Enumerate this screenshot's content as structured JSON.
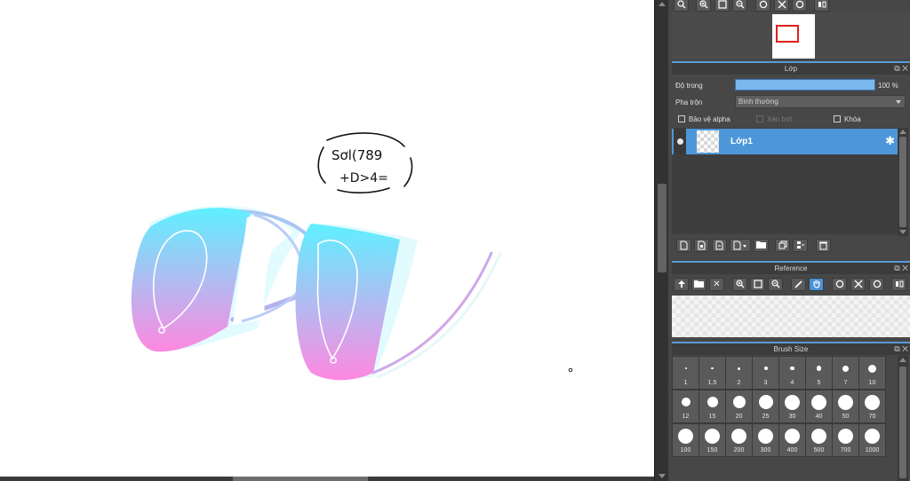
{
  "colors": {
    "accent": "#4d97d8",
    "gradient_cyan": "#5ff0ff",
    "gradient_pink": "#ff8fe0"
  },
  "canvas": {
    "sketch_note_line1": "Sơl(789",
    "sketch_note_line2": "+D>4="
  },
  "navigator": {
    "toolbar_icons": [
      "zoom-in-icon",
      "zoom-in-plus-icon",
      "fit-window-icon",
      "zoom-out-icon",
      "rotate-left-icon",
      "fit-icon",
      "rotate-right-icon",
      "flip-icon"
    ]
  },
  "layer_panel": {
    "title": "Lớp",
    "opacity_label": "Độ trong",
    "opacity_value": "100 %",
    "opacity_fraction": 1.0,
    "blend_label": "Pha trộn",
    "blend_value": "Bình thường",
    "protect_alpha_label": "Bảo vệ alpha",
    "clipping_label": "Xén bớt",
    "lock_label": "Khóa",
    "layers": [
      {
        "name": "Lớp1",
        "selected": true,
        "visible": true
      }
    ],
    "action_icons": [
      "new-layer-icon",
      "new-layer-8bit-icon",
      "new-layer-1bit-icon",
      "add-layer-menu-icon",
      "folder-icon",
      "duplicate-icon",
      "merge-icon",
      "delete-icon"
    ]
  },
  "reference_panel": {
    "title": "Reference",
    "toolbar_icons": [
      "upload-icon",
      "open-folder-icon",
      "close-icon",
      "zoom-in-icon",
      "fit-window-icon",
      "zoom-out-icon",
      "eyedropper-icon",
      "hand-icon",
      "rotate-left-icon",
      "fit-icon",
      "rotate-right-icon",
      "flip-icon"
    ]
  },
  "brush_size_panel": {
    "title": "Brush Size",
    "sizes": [
      "1",
      "1.5",
      "2",
      "3",
      "4",
      "5",
      "7",
      "10",
      "12",
      "15",
      "20",
      "25",
      "30",
      "40",
      "50",
      "70",
      "100",
      "150",
      "200",
      "300",
      "400",
      "500",
      "700",
      "1000"
    ]
  }
}
